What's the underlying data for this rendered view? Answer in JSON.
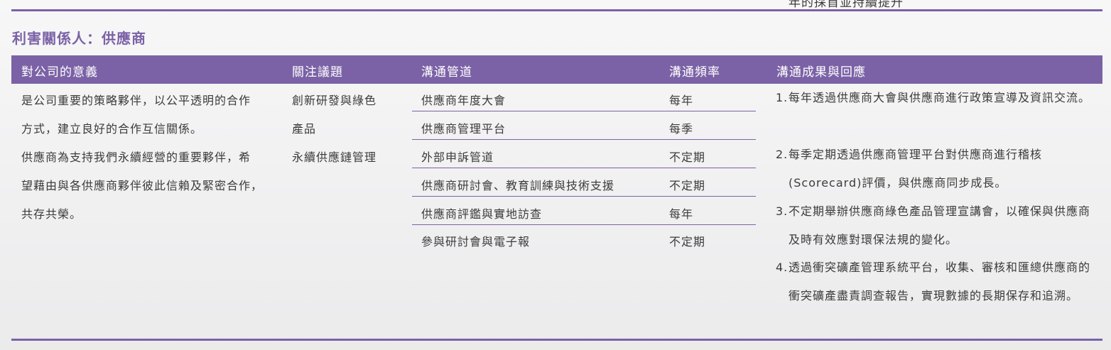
{
  "cut_text": "年的採首並持續提升",
  "section_title": "利害關係人：供應商",
  "headers": [
    "對公司的意義",
    "關注議題",
    "溝通管道",
    "溝通頻率",
    "溝通成果與回應"
  ],
  "significance_lines": [
    "是公司重要的策略夥伴，以公平透明的合作",
    "方式，建立良好的合作互信關係。",
    "供應商為支持我們永續經營的重要夥伴，希",
    "望藉由與各供應商夥伴彼此信賴及緊密合作，",
    "共存共榮。"
  ],
  "topic_lines": [
    "創新研發與綠色",
    "產品",
    "永續供應鏈管理"
  ],
  "channels": [
    {
      "name": "供應商年度大會",
      "frequency": "每年"
    },
    {
      "name": "供應商管理平台",
      "frequency": "每季"
    },
    {
      "name": "外部申訴管道",
      "frequency": "不定期"
    },
    {
      "name": "供應商研討會、教育訓練與技術支援",
      "frequency": "不定期"
    },
    {
      "name": "供應商評鑑與實地訪查",
      "frequency": "每年"
    },
    {
      "name": "參與研討會與電子報",
      "frequency": "不定期"
    }
  ],
  "outcomes": [
    {
      "num": "1.",
      "text": "每年透過供應商大會與供應商進行政策宣導及資訊交流。"
    },
    {
      "num": "2.",
      "text": "每季定期透過供應商管理平台對供應商進行稽核(Scorecard)評價，與供應商同步成長。"
    },
    {
      "num": "3.",
      "text": "不定期舉辦供應商綠色產品管理宣講會，以確保與供應商及時有效應對環保法規的變化。"
    },
    {
      "num": "4.",
      "text": "透過衝突礦產管理系統平台，收集、審核和匯總供應商的衝突礦產盡責調查報告，實現數據的長期保存和追溯。"
    }
  ],
  "colors": {
    "accent": "#7b62a6",
    "header_text": "#ffffff",
    "body_text": "#3b3b3b"
  }
}
